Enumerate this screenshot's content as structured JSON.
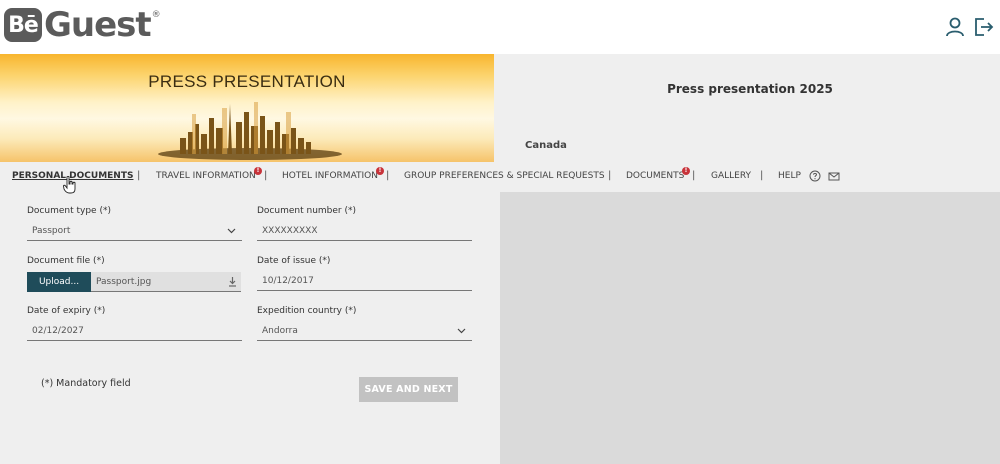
{
  "brand": {
    "logo_box": "Bē",
    "logo_text": "Guest",
    "registered": "®"
  },
  "header": {
    "icons": [
      "user-icon",
      "logout-icon"
    ]
  },
  "banner": {
    "title": "PRESS PRESENTATION",
    "colors": {
      "top": "#f8b52e",
      "mid": "#fff8e2"
    }
  },
  "event": {
    "title": "Press presentation 2025",
    "country": "Canada"
  },
  "nav": {
    "items": [
      {
        "label": "PERSONAL DOCUMENTS",
        "active": true
      },
      {
        "label": "TRAVEL INFORMATION",
        "badge": "!"
      },
      {
        "label": "HOTEL INFORMATION",
        "badge": "!"
      },
      {
        "label": "GROUP PREFERENCES & SPECIAL REQUESTS"
      },
      {
        "label": "DOCUMENTS",
        "badge": "!"
      },
      {
        "label": "GALLERY"
      },
      {
        "label": "HELP"
      }
    ],
    "separator": "|",
    "help_icons": [
      "question-circle-icon",
      "envelope-icon"
    ]
  },
  "form": {
    "document_type": {
      "label": "Document type (*)",
      "value": "Passport"
    },
    "document_number": {
      "label": "Document number (*)",
      "value": "XXXXXXXXX"
    },
    "document_file": {
      "label": "Document file (*)",
      "button": "Upload...",
      "file_name": "Passport.jpg"
    },
    "date_of_issue": {
      "label": "Date of issue (*)",
      "value": "10/12/2017"
    },
    "date_of_expiry": {
      "label": "Date of expiry (*)",
      "value": "02/12/2027"
    },
    "expedition_country": {
      "label": "Expedition country (*)",
      "value": "Andorra"
    },
    "mandatory_note": "(*) Mandatory field",
    "save_button": "SAVE AND NEXT"
  },
  "colors": {
    "upload_button": "#1f4c5a",
    "badge": "#c8333a",
    "save_button_disabled": "#c2c2c2",
    "accent_icon": "#2a5d6e"
  }
}
